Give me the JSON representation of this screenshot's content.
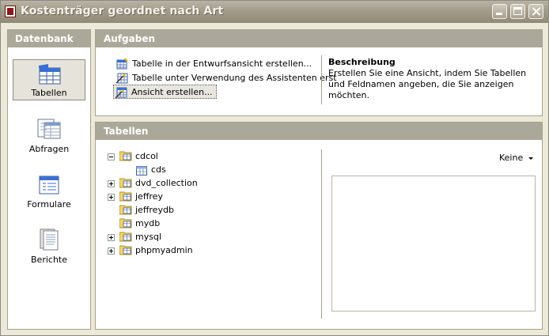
{
  "window": {
    "title": "Kostenträger geordnet nach Art"
  },
  "sidebar": {
    "header": "Datenbank",
    "items": [
      {
        "label": "Tabellen",
        "icon": "tables-icon",
        "selected": true
      },
      {
        "label": "Abfragen",
        "icon": "queries-icon",
        "selected": false
      },
      {
        "label": "Formulare",
        "icon": "forms-icon",
        "selected": false
      },
      {
        "label": "Berichte",
        "icon": "reports-icon",
        "selected": false
      }
    ]
  },
  "tasks": {
    "header": "Aufgaben",
    "items": [
      {
        "label": "Tabelle in der Entwurfsansicht erstellen...",
        "icon": "design-table-icon"
      },
      {
        "label": "Tabelle unter Verwendung des Assistenten erst",
        "icon": "wizard-table-icon"
      },
      {
        "label": "Ansicht erstellen...",
        "icon": "create-view-icon",
        "focused": true
      }
    ],
    "description_title": "Beschreibung",
    "description_text": "Erstellen Sie eine Ansicht, indem Sie Tabellen und Feldnamen angeben, die Sie anzeigen möchten."
  },
  "tables": {
    "header": "Tabellen",
    "tree": [
      {
        "label": "cdcol",
        "expander": "minus",
        "children": [
          {
            "label": "cds"
          }
        ]
      },
      {
        "label": "dvd_collection",
        "expander": "plus"
      },
      {
        "label": "jeffrey",
        "expander": "plus"
      },
      {
        "label": "jeffreydb",
        "expander": "none"
      },
      {
        "label": "mydb",
        "expander": "none"
      },
      {
        "label": "mysql",
        "expander": "plus"
      },
      {
        "label": "phpmyadmin",
        "expander": "plus"
      }
    ],
    "preview_mode": "Keine"
  },
  "colors": {
    "header_bg": "#aca899",
    "window_bg": "#ece9d8",
    "titlebar": "#a39c8b"
  }
}
